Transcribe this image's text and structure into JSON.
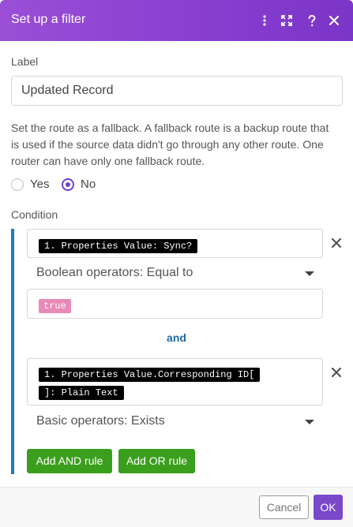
{
  "dialog": {
    "title": "Set up a filter",
    "icons": [
      "more-vertical-icon",
      "expand-icon",
      "help-icon",
      "close-icon"
    ]
  },
  "label_field": {
    "label": "Label",
    "value": "Updated Record"
  },
  "fallback": {
    "description": "Set the route as a fallback. A fallback route is a backup route that is used if the source data didn't go through any other route. One router can have only one fallback route.",
    "options": [
      {
        "label": "Yes",
        "selected": false
      },
      {
        "label": "No",
        "selected": true
      }
    ]
  },
  "condition": {
    "title": "Condition",
    "rules": [
      {
        "operand1": "1. Properties Value: Sync?",
        "operator": "Boolean operators: Equal to",
        "operand2": "true"
      },
      {
        "operand1_line1": "1. Properties Value.Corresponding ID[",
        "operand1_line2": "]: Plain Text",
        "operator": "Basic operators: Exists"
      }
    ],
    "joiner": "and",
    "add_and_label": "Add AND rule",
    "add_or_label": "Add OR rule"
  },
  "footer": {
    "cancel_label": "Cancel",
    "ok_label": "OK"
  },
  "colors": {
    "header_gradient_start": "#9a4fd6",
    "header_gradient_end": "#7b35c8",
    "condition_bar": "#1f7ab8",
    "green_button": "#3a9f1c",
    "ok_button": "#7a48c8",
    "radio_selected": "#6f3fd0",
    "true_pill": "#e88ab8"
  }
}
